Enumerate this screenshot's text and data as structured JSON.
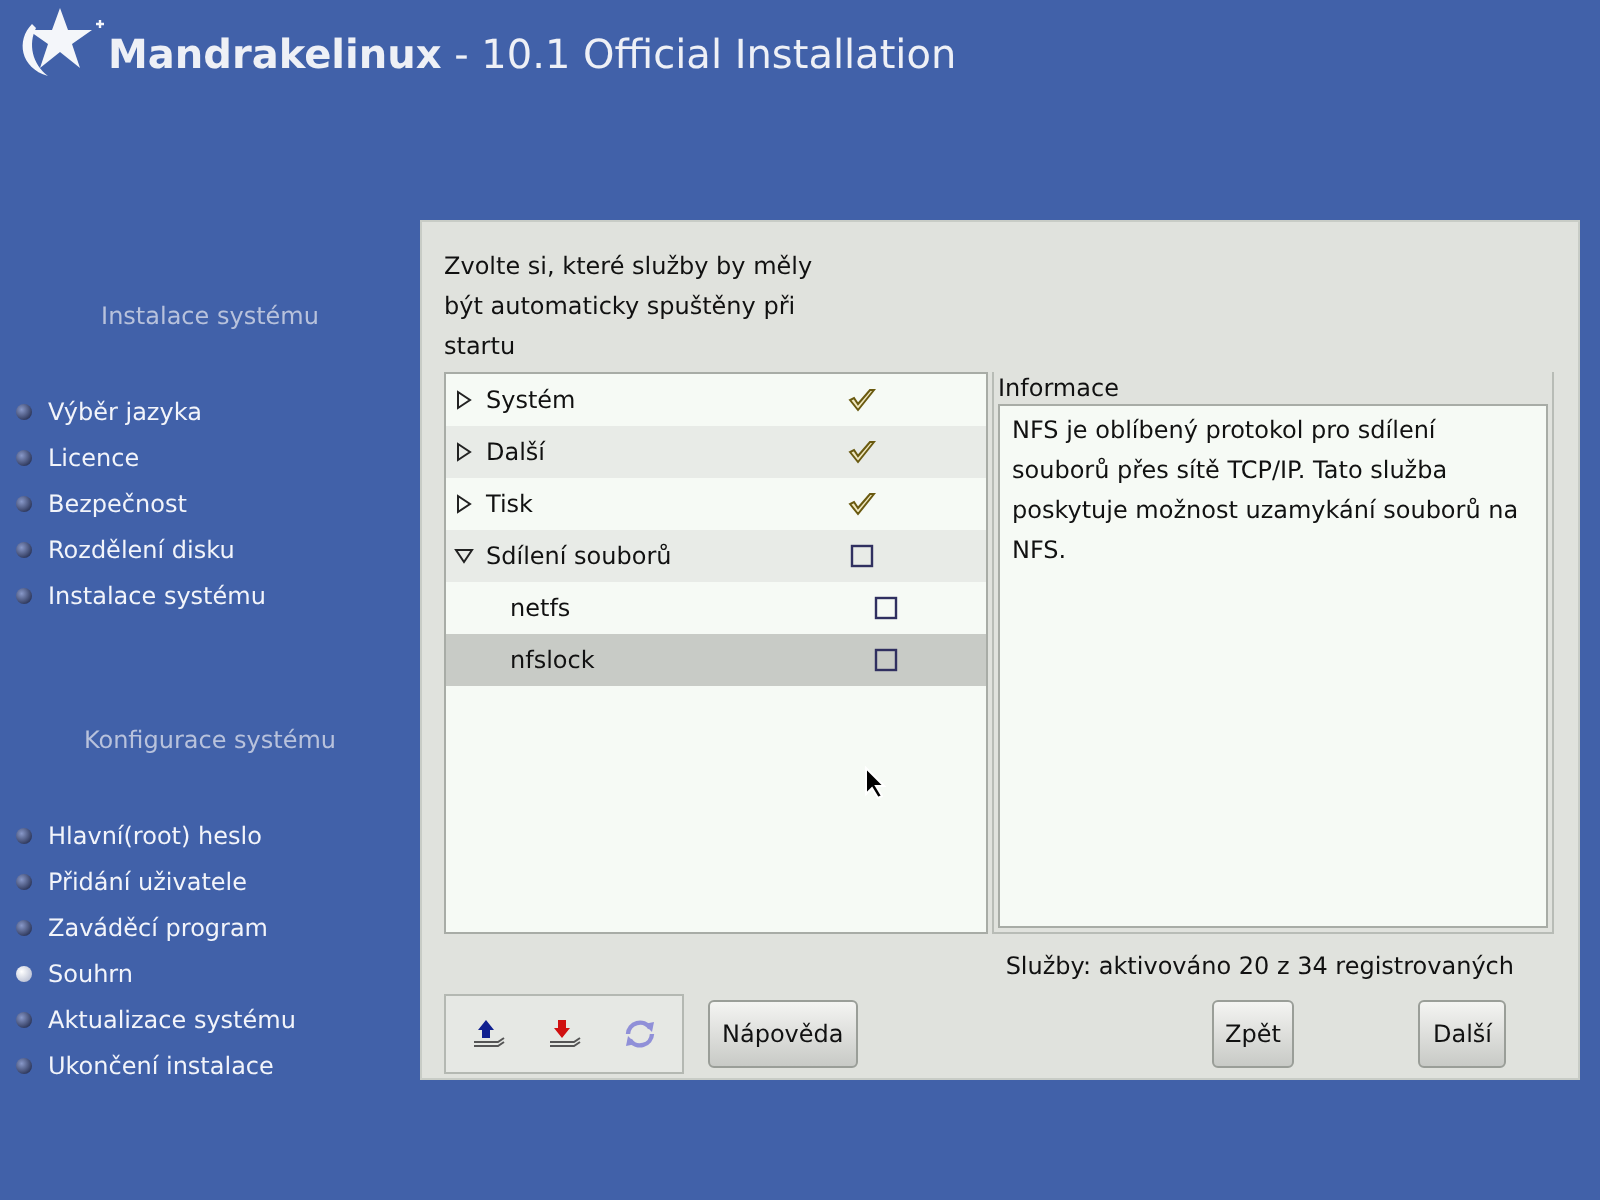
{
  "header": {
    "brand": "Mandrakelinux",
    "subtitle": " - 10.1 Official Installation"
  },
  "sidebar": {
    "sections": [
      {
        "title": "Instalace systému",
        "steps": [
          {
            "label": "Výběr jazyka",
            "selected": false
          },
          {
            "label": "Licence",
            "selected": false
          },
          {
            "label": "Bezpečnost",
            "selected": false
          },
          {
            "label": "Rozdělení disku",
            "selected": false
          },
          {
            "label": "Instalace systému",
            "selected": false
          }
        ]
      },
      {
        "title": "Konfigurace systému",
        "steps": [
          {
            "label": "Hlavní(root) heslo",
            "selected": false
          },
          {
            "label": "Přidání uživatele",
            "selected": false
          },
          {
            "label": "Zaváděcí program",
            "selected": false
          },
          {
            "label": "Souhrn",
            "selected": true
          },
          {
            "label": "Aktualizace systému",
            "selected": false
          },
          {
            "label": "Ukončení instalace",
            "selected": false
          }
        ]
      }
    ]
  },
  "panel": {
    "prompt": "Zvolte si, které služby by měly být automaticky spuštěny při startu",
    "tree": [
      {
        "label": "Systém",
        "checked": true,
        "expanded": false,
        "selected": false
      },
      {
        "label": "Další",
        "checked": true,
        "expanded": false,
        "selected": false
      },
      {
        "label": "Tisk",
        "checked": true,
        "expanded": false,
        "selected": false
      },
      {
        "label": "Sdílení souborů",
        "checked": false,
        "expanded": true,
        "selected": false,
        "children": [
          {
            "label": "netfs",
            "checked": false,
            "selected": false
          },
          {
            "label": "nfslock",
            "checked": false,
            "selected": true
          }
        ]
      }
    ],
    "info": {
      "title": "Informace",
      "text": "NFS je oblíbený protokol pro sdílení souborů přes sítě TCP/IP. Tato služba poskytuje možnost uzamykání souborů na NFS."
    },
    "status": "Služby: aktivováno 20 z 34 registrovaných",
    "buttons": {
      "help": "Nápověda",
      "back": "Zpět",
      "next": "Další"
    }
  }
}
